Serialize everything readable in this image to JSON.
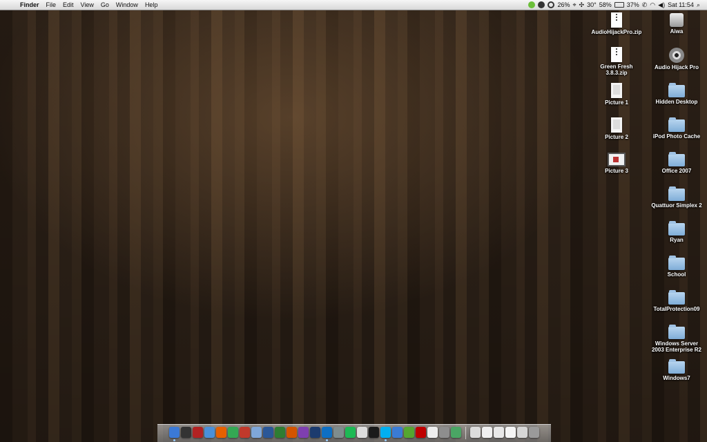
{
  "menubar": {
    "apple_glyph": "",
    "items": [
      "Finder",
      "File",
      "Edit",
      "View",
      "Go",
      "Window",
      "Help"
    ],
    "status": {
      "cpu_percent": "26%",
      "temperature": "30°",
      "fan_percent": "58%",
      "battery_percent": "37%",
      "clock": "Sat 11:54",
      "spotlight_glyph": "⌕"
    }
  },
  "desktop": {
    "icons": [
      {
        "label": "AudioHijackPro.zip",
        "type": "zip"
      },
      {
        "label": "Green Fresh\n3.8.3.zip",
        "type": "zip"
      },
      {
        "label": "Picture 1",
        "type": "picture"
      },
      {
        "label": "Picture 2",
        "type": "picture"
      },
      {
        "label": "Picture 3",
        "type": "picture-wide"
      },
      {
        "label": "Aiwa",
        "type": "hard-disk"
      },
      {
        "label": "Audio Hijack Pro",
        "type": "disc"
      },
      {
        "label": "Hidden Desktop",
        "type": "folder"
      },
      {
        "label": "iPod Photo Cache",
        "type": "folder"
      },
      {
        "label": "Office 2007",
        "type": "folder"
      },
      {
        "label": "Quattuor Simplex 2",
        "type": "folder"
      },
      {
        "label": "Ryan",
        "type": "folder"
      },
      {
        "label": "School",
        "type": "folder"
      },
      {
        "label": "TotalProtection09",
        "type": "folder"
      },
      {
        "label": "Windows Server\n2003 Enterprise R2",
        "type": "folder"
      },
      {
        "label": "Windows7",
        "type": "folder"
      }
    ]
  },
  "dock": {
    "apps": [
      {
        "name": "finder",
        "color": "#3b79d6",
        "running": true
      },
      {
        "name": "dashboard",
        "color": "#333333",
        "running": false
      },
      {
        "name": "address-book",
        "color": "#b22222",
        "running": false
      },
      {
        "name": "safari",
        "color": "#4a90d9",
        "running": false
      },
      {
        "name": "firefox",
        "color": "#e66000",
        "running": false
      },
      {
        "name": "chrome",
        "color": "#34a853",
        "running": false
      },
      {
        "name": "itunes",
        "color": "#c0392b",
        "running": false
      },
      {
        "name": "preview",
        "color": "#7fa7d9",
        "running": false
      },
      {
        "name": "word",
        "color": "#2b5797",
        "running": false
      },
      {
        "name": "excel",
        "color": "#2e7d32",
        "running": false
      },
      {
        "name": "powerpoint",
        "color": "#d35400",
        "running": false
      },
      {
        "name": "onenote",
        "color": "#7e3fb0",
        "running": false
      },
      {
        "name": "photoshop",
        "color": "#1c3b6e",
        "running": false
      },
      {
        "name": "teamviewer",
        "color": "#0e6fc3",
        "running": true
      },
      {
        "name": "system-preferences",
        "color": "#7f8c8d",
        "running": false
      },
      {
        "name": "spotify",
        "color": "#1db954",
        "running": false
      },
      {
        "name": "vlc",
        "color": "#dddddd",
        "running": false
      },
      {
        "name": "terminal",
        "color": "#1a1a1a",
        "running": false
      },
      {
        "name": "skype",
        "color": "#00aff0",
        "running": true
      },
      {
        "name": "xcode",
        "color": "#3a7bd5",
        "running": false
      },
      {
        "name": "activity-monitor",
        "color": "#55a630",
        "running": false
      },
      {
        "name": "filezilla",
        "color": "#bf0000",
        "running": false
      },
      {
        "name": "textedit",
        "color": "#eeeeee",
        "running": false
      },
      {
        "name": "automator",
        "color": "#8e8e8e",
        "running": false
      },
      {
        "name": "utorrent",
        "color": "#4aa564",
        "running": false
      }
    ],
    "stacks": [
      {
        "name": "applications-stack",
        "color": "#dcdcdc"
      },
      {
        "name": "documents-stack",
        "color": "#f0f0f0"
      },
      {
        "name": "downloads-stack",
        "color": "#e8e8e8"
      },
      {
        "name": "pictures-stack",
        "color": "#f5f5f5"
      },
      {
        "name": "mail-stack",
        "color": "#d6d6d6"
      },
      {
        "name": "trash",
        "color": "#9a9a9a"
      }
    ]
  }
}
